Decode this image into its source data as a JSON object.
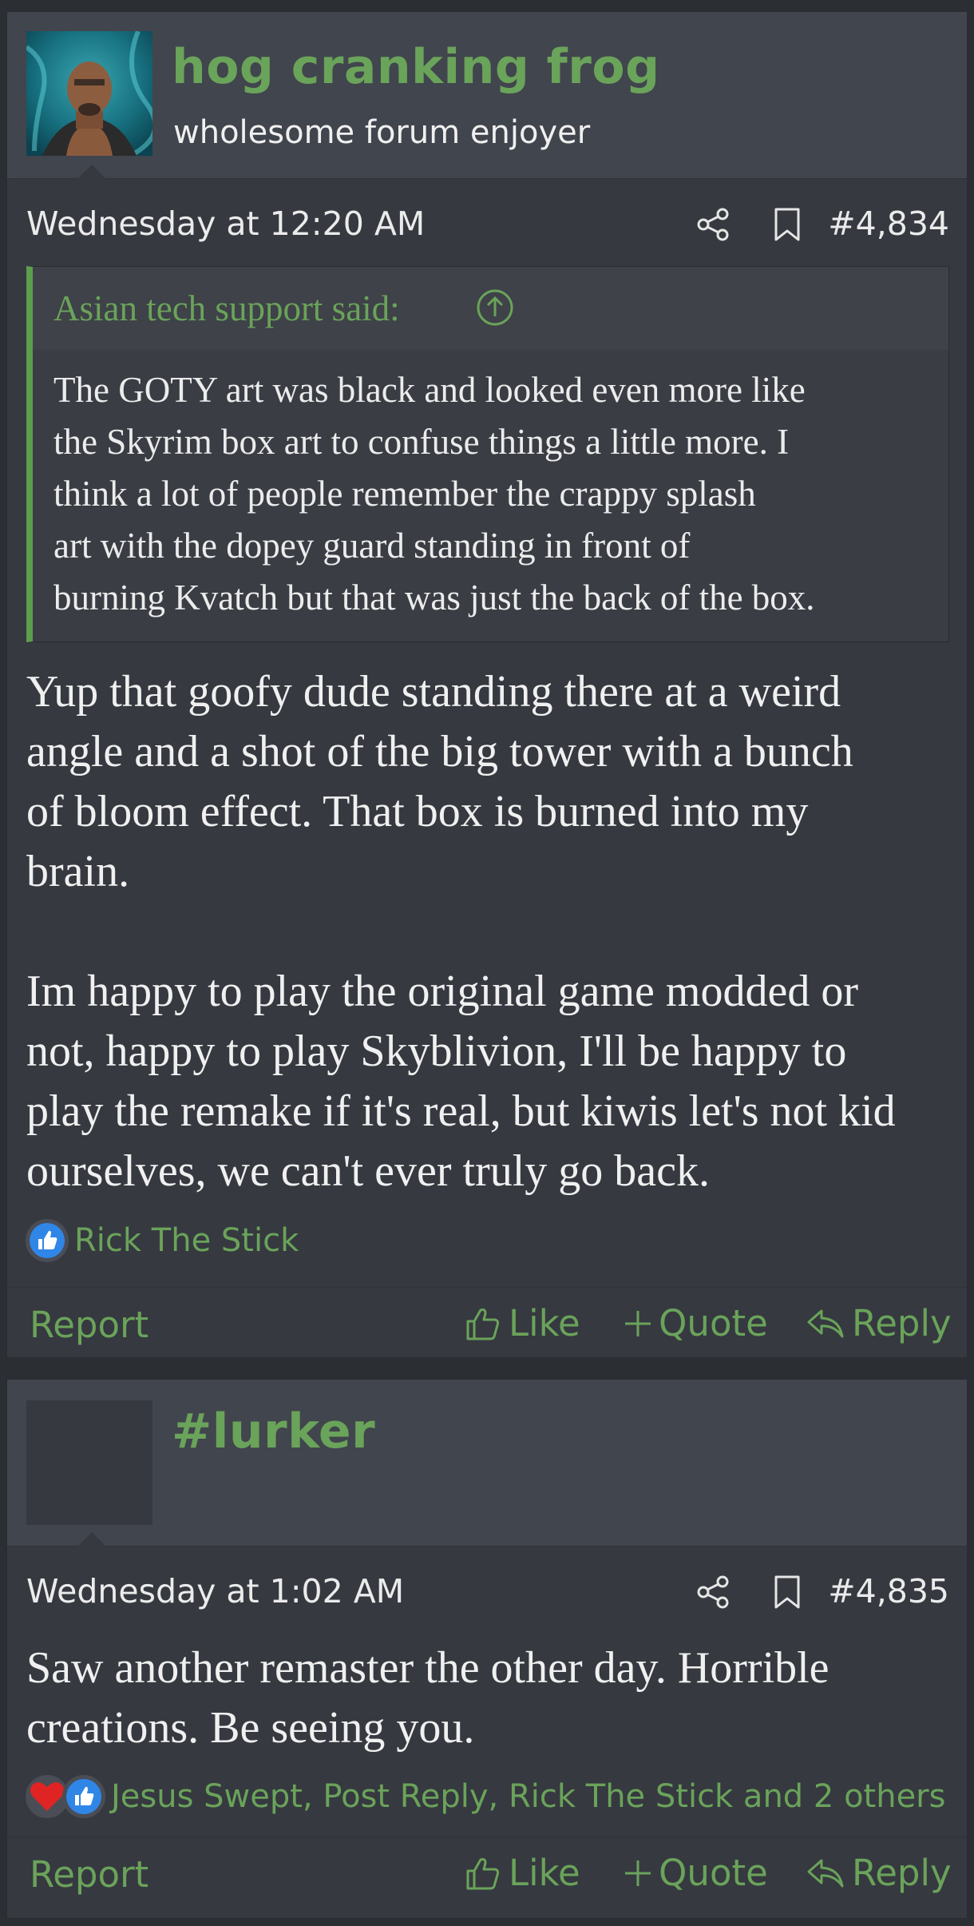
{
  "posts": [
    {
      "username": "hog cranking frog",
      "user_title": "wholesome forum enjoyer",
      "date": "Wednesday at 12:20 AM",
      "post_number": "#4,834",
      "quote": {
        "attribution": "Asian tech support said:",
        "lines": [
          "The GOTY art was black and looked even more like",
          "the Skyrim box art to confuse things a little more. I",
          "think a lot of people remember the crappy splash",
          "art with the dopey guard standing in front of",
          "burning Kvatch but that was just the back of the box."
        ]
      },
      "body_lines": [
        "Yup that goofy dude standing there at a weird",
        "angle and a shot of the big tower with a bunch",
        "of bloom effect. That box is burned into my",
        "brain.",
        "",
        "Im happy to play the original game modded or",
        "not, happy to play Skyblivion, I'll be happy to",
        "play the remake if it's real, but kiwis let's not kid",
        "ourselves, we can't ever truly go back."
      ],
      "reactions": {
        "icons": [
          "like-reaction-icon"
        ],
        "names": "Rick The Stick"
      },
      "actions": {
        "report": "Report",
        "like": "Like",
        "quote": "Quote",
        "reply": "Reply"
      }
    },
    {
      "username": "#lurker",
      "user_title": "",
      "date": "Wednesday at 1:02 AM",
      "post_number": "#4,835",
      "body_lines": [
        "Saw another remaster the other day. Horrible",
        "creations. Be seeing you."
      ],
      "reactions": {
        "icons": [
          "heart-reaction-icon",
          "like-reaction-icon"
        ],
        "names": "Jesus Swept, Post Reply, Rick The Stick and 2 others"
      },
      "actions": {
        "report": "Report",
        "like": "Like",
        "quote": "Quote",
        "reply": "Reply"
      }
    }
  ],
  "colors": {
    "accent": "#6aa35a",
    "background": "#2b2e33",
    "post_bg": "#363940",
    "header_bg": "#41454d",
    "like_blue": "#2f86e6",
    "heart_red": "#e02424"
  }
}
